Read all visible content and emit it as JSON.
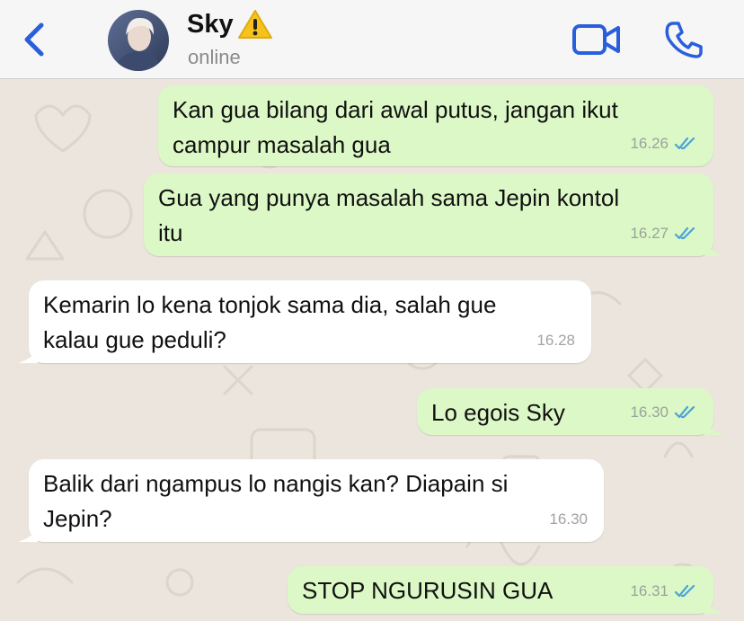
{
  "header": {
    "contact_name": "Sky",
    "status": "online"
  },
  "icons": {
    "back": "chevron-left-icon",
    "warning": "warning-icon",
    "video": "video-camera-icon",
    "call": "phone-icon",
    "read": "double-check-icon"
  },
  "colors": {
    "accent": "#2a5fdc",
    "outgoing_bubble": "#dcf8c6",
    "incoming_bubble": "#ffffff",
    "read_ticks": "#4aa3d8"
  },
  "messages": [
    {
      "direction": "out",
      "text": "Kan gua bilang dari awal putus, jangan ikut\ncampur masalah gua",
      "time": "16.26",
      "read": true
    },
    {
      "direction": "out",
      "text": "Gua yang punya masalah sama Jepin kontol\nitu",
      "time": "16.27",
      "read": true
    },
    {
      "direction": "in",
      "text": "Kemarin lo kena tonjok sama dia, salah gue\nkalau gue peduli?",
      "time": "16.28"
    },
    {
      "direction": "out",
      "text": "Lo egois Sky",
      "time": "16.30",
      "read": true
    },
    {
      "direction": "in",
      "text": "Balik dari ngampus lo nangis kan? Diapain si\nJepin?",
      "time": "16.30"
    },
    {
      "direction": "out",
      "text": "STOP NGURUSIN GUA",
      "time": "16.31",
      "read": true
    }
  ]
}
